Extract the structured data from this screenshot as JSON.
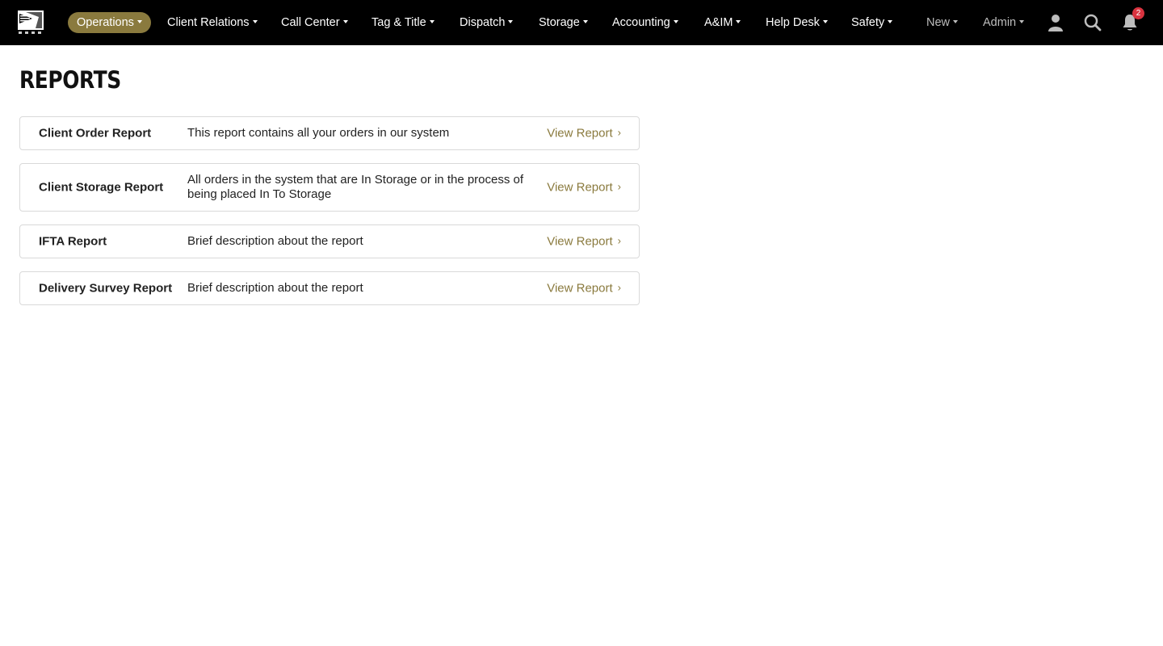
{
  "nav": {
    "items": [
      {
        "label": "Operations"
      },
      {
        "label": "Client Relations"
      },
      {
        "label": "Call Center"
      },
      {
        "label": "Tag & Title"
      },
      {
        "label": "Dispatch"
      },
      {
        "label": "Storage"
      },
      {
        "label": "Accounting"
      },
      {
        "label": "A&IM"
      },
      {
        "label": "Help Desk"
      },
      {
        "label": "Safety"
      },
      {
        "label": "New"
      },
      {
        "label": "Admin"
      }
    ],
    "notification_count": "2",
    "accent_color": "#8a7a3e"
  },
  "page": {
    "title": "REPORTS"
  },
  "reports": [
    {
      "name": "Client Order Report",
      "description": "This report contains all your orders in our system",
      "link": "View Report"
    },
    {
      "name": "Client Storage Report",
      "description": "All orders in the system that are In Storage or in the process of being placed In To Storage",
      "link": "View Report"
    },
    {
      "name": "IFTA Report",
      "description": "Brief description about the report",
      "link": "View Report"
    },
    {
      "name": "Delivery Survey Report",
      "description": "Brief description about the report",
      "link": "View Report"
    }
  ]
}
